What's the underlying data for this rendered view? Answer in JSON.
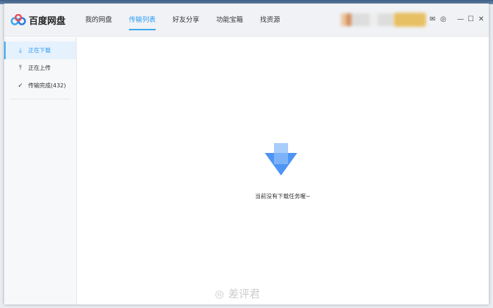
{
  "app": {
    "name": "百度网盘"
  },
  "tabs": [
    {
      "label": "我的网盘"
    },
    {
      "label": "传输列表"
    },
    {
      "label": "好友分享"
    },
    {
      "label": "功能宝箱"
    },
    {
      "label": "找资源"
    }
  ],
  "sidebar": {
    "items": [
      {
        "label": "正在下载"
      },
      {
        "label": "正在上传"
      },
      {
        "label": "传输完成(432)"
      }
    ]
  },
  "empty": {
    "message": "当前没有下载任务喔~"
  },
  "watermark": "差评君",
  "colors": {
    "accent": "#2a9cf5",
    "arrow": "#4d94f5"
  }
}
